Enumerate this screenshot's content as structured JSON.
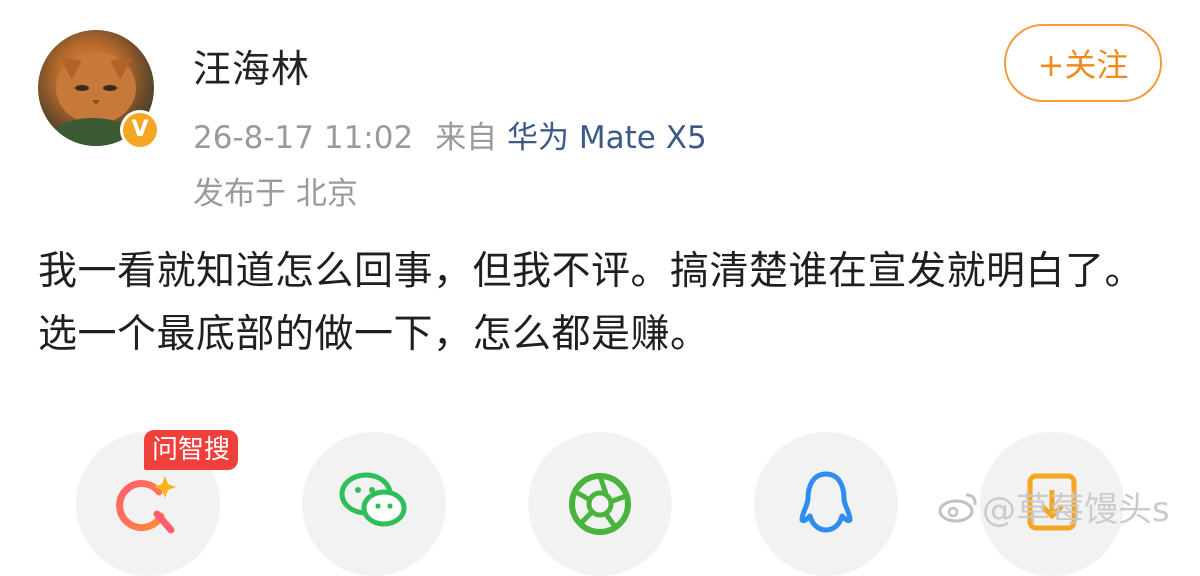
{
  "post": {
    "username": "汪海林",
    "verified_badge": "V",
    "timestamp": "26-8-17 11:02",
    "source_prefix": "来自",
    "device": "华为 Mate X5",
    "location": "发布于 北京",
    "follow_label": "+关注",
    "text": "我一看就知道怎么回事，但我不评。搞清楚谁在宣发就明白了。选一个最底部的做一下，怎么都是赚。"
  },
  "share_bar": {
    "ai_badge_label": "问智搜",
    "icons": [
      "ai-search-icon",
      "wechat-icon",
      "moments-icon",
      "qq-icon",
      "save-download-icon"
    ]
  },
  "watermark": {
    "text": "@草莓馒头s"
  },
  "colors": {
    "accent_orange": "#f08a1e",
    "device_link": "#3c5a86",
    "meta_gray": "#9a9a9a",
    "badge_red": "#f0403c",
    "verified_gold": "#f5a623"
  }
}
